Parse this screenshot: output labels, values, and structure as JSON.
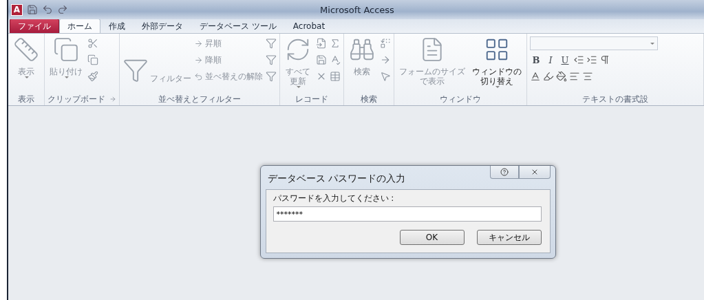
{
  "window": {
    "title": "Microsoft Access",
    "app_logo": "A"
  },
  "tabs": [
    {
      "label": "ファイル",
      "kind": "file",
      "selected": false
    },
    {
      "label": "ホーム",
      "kind": "normal",
      "selected": true
    },
    {
      "label": "作成",
      "kind": "normal",
      "selected": false
    },
    {
      "label": "外部データ",
      "kind": "normal",
      "selected": false
    },
    {
      "label": "データベース ツール",
      "kind": "normal",
      "selected": false
    },
    {
      "label": "Acrobat",
      "kind": "normal",
      "selected": false
    }
  ],
  "ribbon": {
    "groups": [
      {
        "label": "表示",
        "items": [
          {
            "kind": "large",
            "lines": [
              "表示"
            ],
            "dropdown": true,
            "disabled": true
          }
        ]
      },
      {
        "label": "クリップボード",
        "launcher": true,
        "items": [
          {
            "kind": "large",
            "lines": [
              "貼り付け"
            ],
            "dropdown": true,
            "disabled": true
          },
          {
            "kind": "icons"
          }
        ]
      },
      {
        "label": "並べ替えとフィルター",
        "items": [
          {
            "kind": "large-side",
            "lines": [
              "フィルター"
            ],
            "disabled": true
          },
          {
            "kind": "smalls",
            "labels": [
              "昇順",
              "降順",
              "並べ替えの解除"
            ],
            "disabled": true
          },
          {
            "kind": "icons"
          }
        ]
      },
      {
        "label": "レコード",
        "items": [
          {
            "kind": "large",
            "lines": [
              "すべて",
              "更新"
            ],
            "dropdown": true,
            "disabled": true
          },
          {
            "kind": "icons"
          },
          {
            "kind": "icons"
          }
        ]
      },
      {
        "label": "検索",
        "items": [
          {
            "kind": "large",
            "lines": [
              "検索"
            ],
            "disabled": true
          },
          {
            "kind": "icons"
          }
        ]
      },
      {
        "label": "ウィンドウ",
        "items": [
          {
            "kind": "large",
            "lines": [
              "フォームのサイズ",
              "で表示"
            ],
            "disabled": true
          },
          {
            "kind": "large",
            "lines": [
              "ウィンドウの",
              "切り替え"
            ],
            "dropdown": true,
            "disabled": false
          }
        ]
      },
      {
        "label": "テキストの書式設",
        "items": [
          {
            "kind": "format",
            "buttons": [
              "B",
              "I",
              "U"
            ]
          }
        ]
      }
    ]
  },
  "dialog": {
    "title": "データベース パスワードの入力",
    "prompt": "パスワードを入力してください :",
    "value": "*******",
    "buttons": [
      "OK",
      "キャンセル"
    ]
  }
}
